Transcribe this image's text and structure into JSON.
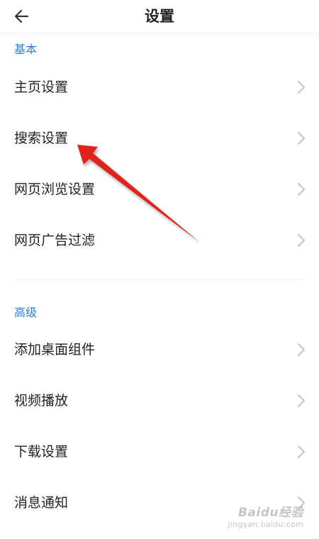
{
  "header": {
    "title": "设置",
    "back_icon": "back-arrow-icon"
  },
  "sections": [
    {
      "label": "基本",
      "items": [
        {
          "label": "主页设置"
        },
        {
          "label": "搜索设置"
        },
        {
          "label": "网页浏览设置"
        },
        {
          "label": "网页广告过滤"
        }
      ]
    },
    {
      "label": "高级",
      "items": [
        {
          "label": "添加桌面组件"
        },
        {
          "label": "视频播放"
        },
        {
          "label": "下载设置"
        },
        {
          "label": "消息通知"
        }
      ]
    }
  ],
  "colors": {
    "section_label": "#2a7de1",
    "annotation_arrow": "#e0201f",
    "chevron": "#c4c4c4"
  },
  "watermark": {
    "brand": "Baidu经验",
    "sub": "jingyan.baidu.com"
  }
}
